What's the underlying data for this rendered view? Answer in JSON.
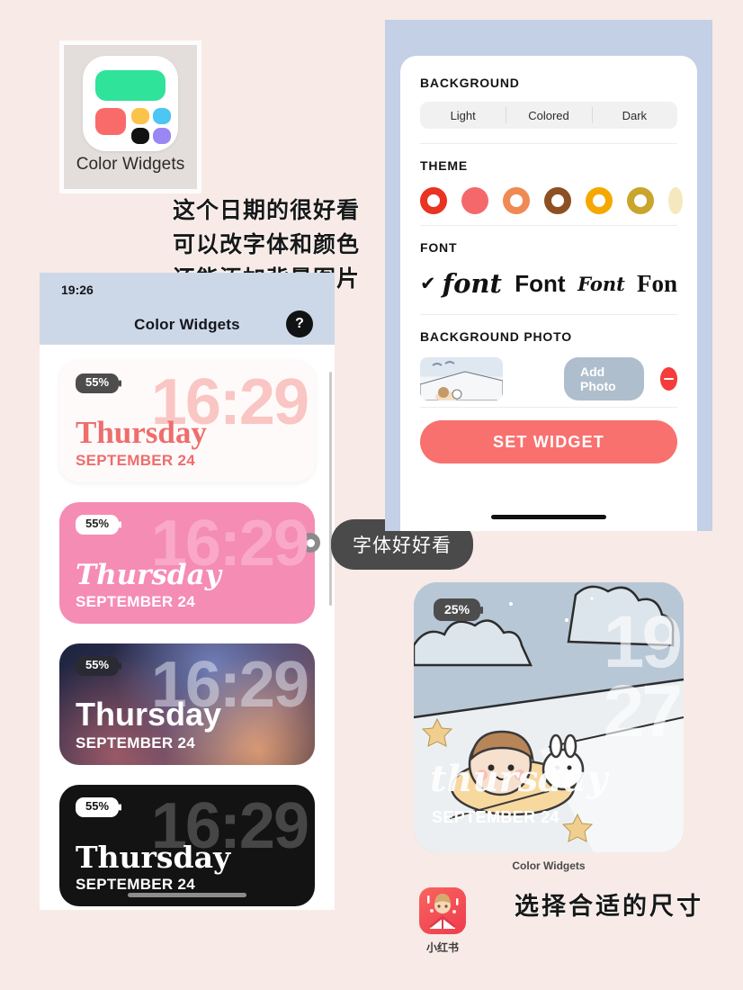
{
  "page": {
    "background_color": "#f8eae6"
  },
  "app_tile": {
    "label": "Color Widgets",
    "icon_name": "color-widgets-app-icon",
    "colors": {
      "green": "#2fe39a",
      "red": "#f96a6a",
      "yellow": "#fcc34a",
      "black": "#121212",
      "blue": "#4cc6f2",
      "purple": "#9b86f5"
    }
  },
  "annotations": {
    "line1": "这个日期的很好看",
    "line2": "可以改字体和颜色",
    "line3": "还能添加背景图片",
    "line4": "选择合适的尺寸",
    "tooltip": "字体好好看"
  },
  "phone": {
    "status_time": "19:26",
    "title": "Color Widgets",
    "help_label": "?",
    "widgets": [
      {
        "style": "light",
        "battery": "55%",
        "time": "16:29",
        "day": "Thursday",
        "date": "SEPTEMBER 24",
        "accent": "#ee6d6d"
      },
      {
        "style": "pink",
        "battery": "55%",
        "time": "16:29",
        "day": "Thursday",
        "date": "SEPTEMBER 24",
        "accent": "#f58cb4"
      },
      {
        "style": "gradient",
        "battery": "55%",
        "time": "16:29",
        "day": "Thursday",
        "date": "SEPTEMBER 24",
        "accent": "#3a3352"
      },
      {
        "style": "black",
        "battery": "55%",
        "time": "16:29",
        "day": "Thursday",
        "date": "SEPTEMBER 24",
        "accent": "#131313"
      }
    ]
  },
  "settings": {
    "background_section": {
      "title": "BACKGROUND",
      "options": [
        "Light",
        "Colored",
        "Dark"
      ],
      "selected": "Light"
    },
    "theme_section": {
      "title": "THEME",
      "swatches": [
        {
          "color": "#e93323",
          "filled": false,
          "selected": false
        },
        {
          "color": "#f4686c",
          "filled": true,
          "selected": true
        },
        {
          "color": "#ef8a55",
          "filled": false,
          "selected": false
        },
        {
          "color": "#8d5022",
          "filled": false,
          "selected": false
        },
        {
          "color": "#f5a800",
          "filled": false,
          "selected": false
        },
        {
          "color": "#c9a52c",
          "filled": false,
          "selected": false
        },
        {
          "color": "#f5e8bf",
          "filled": false,
          "selected": false
        }
      ]
    },
    "font_section": {
      "title": "FONT",
      "check_glyph": "✔",
      "options": [
        "font",
        "Font",
        "Font",
        "Fon"
      ],
      "selected_index": 0
    },
    "background_photo_section": {
      "title": "BACKGROUND PHOTO",
      "add_photo_label": "Add Photo",
      "remove_label": "−",
      "thumb_name": "background-photo-thumbnail"
    },
    "set_widget_label": "SET WIDGET",
    "accent_color": "#f8716f"
  },
  "big_widget": {
    "battery": "25%",
    "time_line1": "19",
    "time_line2": "27",
    "day": "thursday",
    "date": "SEPTEMBER 24",
    "caption": "Color Widgets"
  },
  "xhs": {
    "label": "小红书",
    "icon_name": "xiaohongshu-app-icon"
  }
}
